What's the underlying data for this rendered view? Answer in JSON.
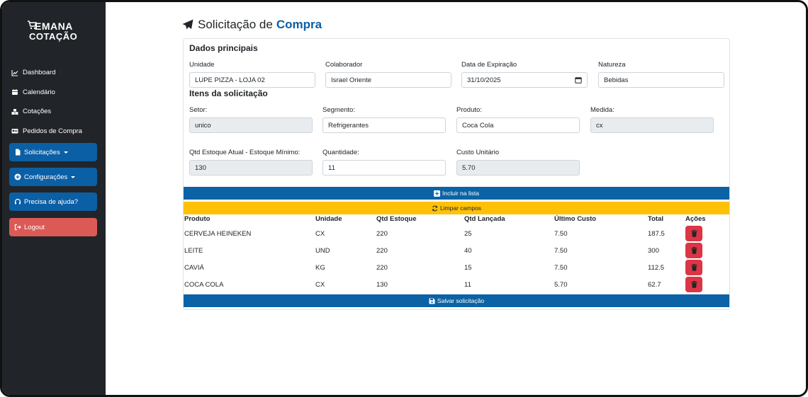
{
  "sidebar": {
    "logo_line1": "EMANA",
    "logo_line2": "COTAÇÃO",
    "nav": [
      {
        "label": "Dashboard",
        "icon": "chart-line-icon"
      },
      {
        "label": "Calendário",
        "icon": "calendar-icon"
      },
      {
        "label": "Cotações",
        "icon": "boxes-icon"
      },
      {
        "label": "Pedidos de Compra",
        "icon": "id-card-icon"
      }
    ],
    "solicitacoes_label": "Solicitações",
    "configuracoes_label": "Configurações",
    "ajuda_label": "Precisa de ajuda?",
    "logout_label": "Logout",
    "colors": {
      "bg": "#212529",
      "primary": "#0b5fa5",
      "danger": "#dc5a55"
    }
  },
  "header": {
    "title_part1": "Solicitação de",
    "title_part2": "Compra"
  },
  "dados": {
    "title": "Dados principais",
    "unidade_label": "Unidade",
    "unidade_value": "LUPE PIZZA - LOJA 02",
    "colaborador_label": "Colaborador",
    "colaborador_value": "Israel Oriente",
    "expiracao_label": "Data de Expiração",
    "expiracao_value": "31/10/2025",
    "natureza_label": "Natureza",
    "natureza_value": "Bebidas"
  },
  "itens": {
    "title": "Itens da solicitação",
    "setor_label": "Setor:",
    "setor_value": "unico",
    "segmento_label": "Segmento:",
    "segmento_value": "Refrigerantes",
    "produto_label": "Produto:",
    "produto_value": "Coca Cola",
    "medida_label": "Medida:",
    "medida_value": "cx",
    "estoque_label": "Qtd Estoque Atual - Estoque Mínimo:",
    "estoque_value": "130",
    "quantidade_label": "Quantidade:",
    "quantidade_value": "11",
    "custo_label": "Custo Unitário",
    "custo_value": "5.70"
  },
  "actions": {
    "incluir_label": "Incluir na lista",
    "limpar_label": "Limpar campos",
    "salvar_label": "Salvar solicitação",
    "colors": {
      "primary": "#0b63a6",
      "warning": "#ffc107",
      "danger": "#dc3545"
    }
  },
  "table": {
    "headers": [
      "Produto",
      "Unidade",
      "Qtd Estoque",
      "Qtd Lançada",
      "Último Custo",
      "Total",
      "Ações"
    ],
    "rows": [
      [
        "CERVEJA HEINEKEN",
        "CX",
        "220",
        "25",
        "7.50",
        "187.5"
      ],
      [
        "LEITE",
        "UND",
        "220",
        "40",
        "7.50",
        "300"
      ],
      [
        "CAVIÁ",
        "KG",
        "220",
        "15",
        "7.50",
        "112.5"
      ],
      [
        "COCA COLA",
        "CX",
        "130",
        "11",
        "5.70",
        "62.7"
      ]
    ]
  }
}
